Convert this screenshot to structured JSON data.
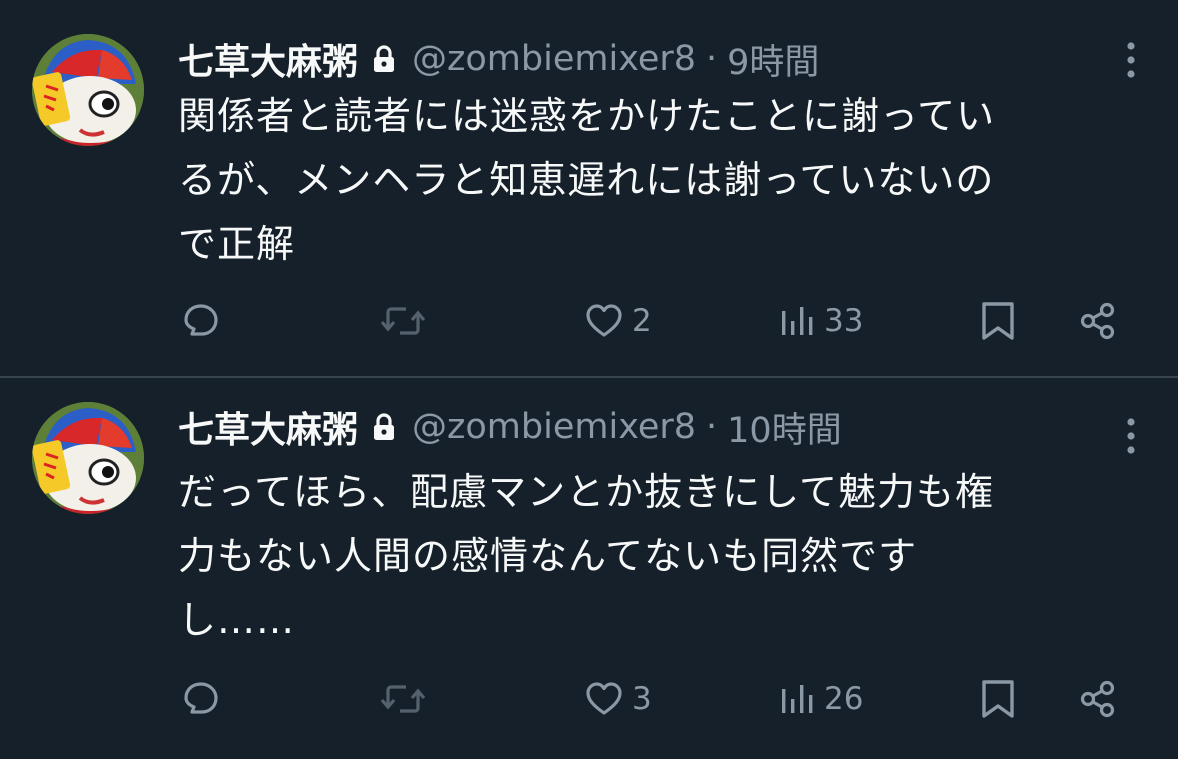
{
  "tweets": [
    {
      "author": {
        "display_name": "七草大麻粥",
        "handle": "@zombiemixer8",
        "protected_icon": "lock-icon"
      },
      "separator": "·",
      "time": "9時間",
      "text_lines": [
        "関係者と読者には迷惑をかけたことに謝ってい",
        "るが、メンヘラと知恵遅れには謝っていないの",
        "で正解"
      ],
      "metrics": {
        "replies": "",
        "retweets": "",
        "likes": "2",
        "views": "33"
      }
    },
    {
      "author": {
        "display_name": "七草大麻粥",
        "handle": "@zombiemixer8",
        "protected_icon": "lock-icon"
      },
      "separator": "·",
      "time": "10時間",
      "text_lines": [
        "だってほら、配慮マンとか抜きにして魅力も権",
        "力もない人間の感情なんてないも同然です",
        "し……"
      ],
      "metrics": {
        "replies": "",
        "retweets": "",
        "likes": "3",
        "views": "26"
      }
    }
  ],
  "colors": {
    "background": "#15202b",
    "text_primary": "#f7f9f9",
    "text_secondary": "#8b98a5",
    "divider": "#38444d"
  },
  "icons": [
    "reply-icon",
    "retweet-icon",
    "like-icon",
    "views-icon",
    "bookmark-icon",
    "share-icon",
    "more-icon"
  ]
}
